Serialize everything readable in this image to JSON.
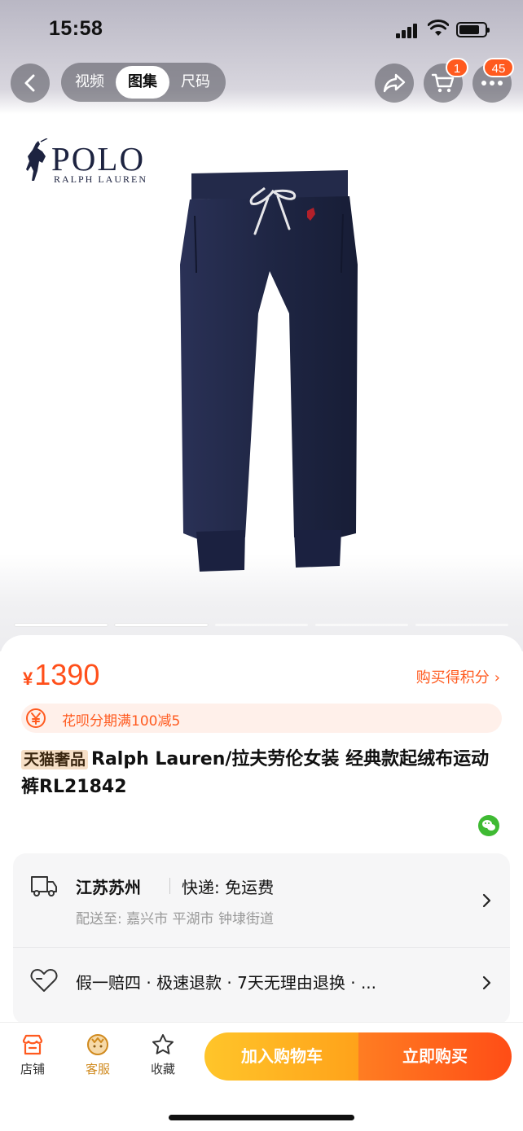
{
  "status_bar": {
    "time": "15:58"
  },
  "nav": {
    "tabs": [
      {
        "label": "视频",
        "active": false
      },
      {
        "label": "图集",
        "active": true
      },
      {
        "label": "尺码",
        "active": false
      }
    ],
    "cart_badge": "1",
    "more_badge": "45",
    "icons": [
      "back-icon",
      "share-icon",
      "cart-icon",
      "more-icon"
    ]
  },
  "hero": {
    "brand_logo": "POLO",
    "brand_logo_sub": "RALPH LAUREN",
    "slide_count": 5,
    "active_slide": 1
  },
  "product": {
    "price_symbol": "¥",
    "price": "1390",
    "points_link": "购买得积分",
    "promo": "花呗分期满100减5",
    "title_tag": "天猫奢品",
    "title": "Ralph Lauren/拉夫劳伦女装 经典款起绒布运动裤RL21842"
  },
  "logistics": {
    "origin": "江苏苏州",
    "shipping": "快递: 免运费",
    "deliver_to": "配送至: 嘉兴市 平湖市 钟埭街道",
    "guarantee": "假一赔四 · 极速退款 · 7天无理由退换 · ..."
  },
  "bottom_bar": {
    "store": "店铺",
    "service": "客服",
    "favorite": "收藏",
    "add_to_cart": "加入购物车",
    "buy_now": "立即购买"
  },
  "colors": {
    "accent": "#ff5a1f",
    "cart_button": "#ffb21f",
    "buy_button": "#ff5a1a",
    "pants": "#1f2644"
  }
}
